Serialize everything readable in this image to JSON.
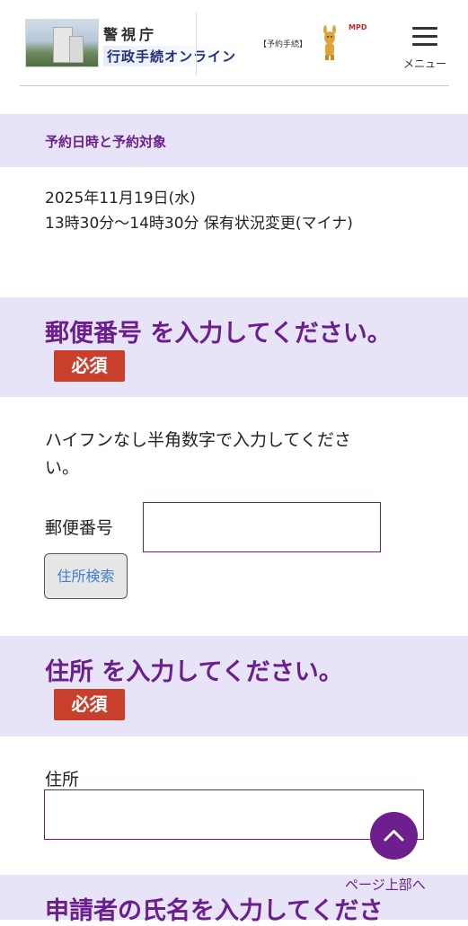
{
  "header": {
    "logo_line1": "警視庁",
    "logo_line2": "行政手続オンライン",
    "reserve_tag": "【予約手続】",
    "mpd_logo": "MPD",
    "menu_label": "メニュー"
  },
  "reservation": {
    "section_title": "予約日時と予約対象",
    "date": "2025年11月19日(水)",
    "time_target": "13時30分～14時30分 保有状況変更(マイナ)"
  },
  "postal": {
    "title": "郵便番号 を入力してください。",
    "required": "必須",
    "instruction_line1": "ハイフンなし半角数字で入力してくださ",
    "instruction_line2": "い。",
    "field_label": "郵便番号",
    "value": "",
    "search_button": "住所検索"
  },
  "address": {
    "title": "住所 を入力してください。",
    "required": "必須",
    "field_label": "住所",
    "value": ""
  },
  "applicant": {
    "title": "申請者の氏名を入力してくださ"
  },
  "page_top": {
    "label": "ページ上部へ"
  },
  "colors": {
    "accent": "#6b1e8e",
    "band": "#e8e4f7",
    "required": "#c8402c"
  }
}
